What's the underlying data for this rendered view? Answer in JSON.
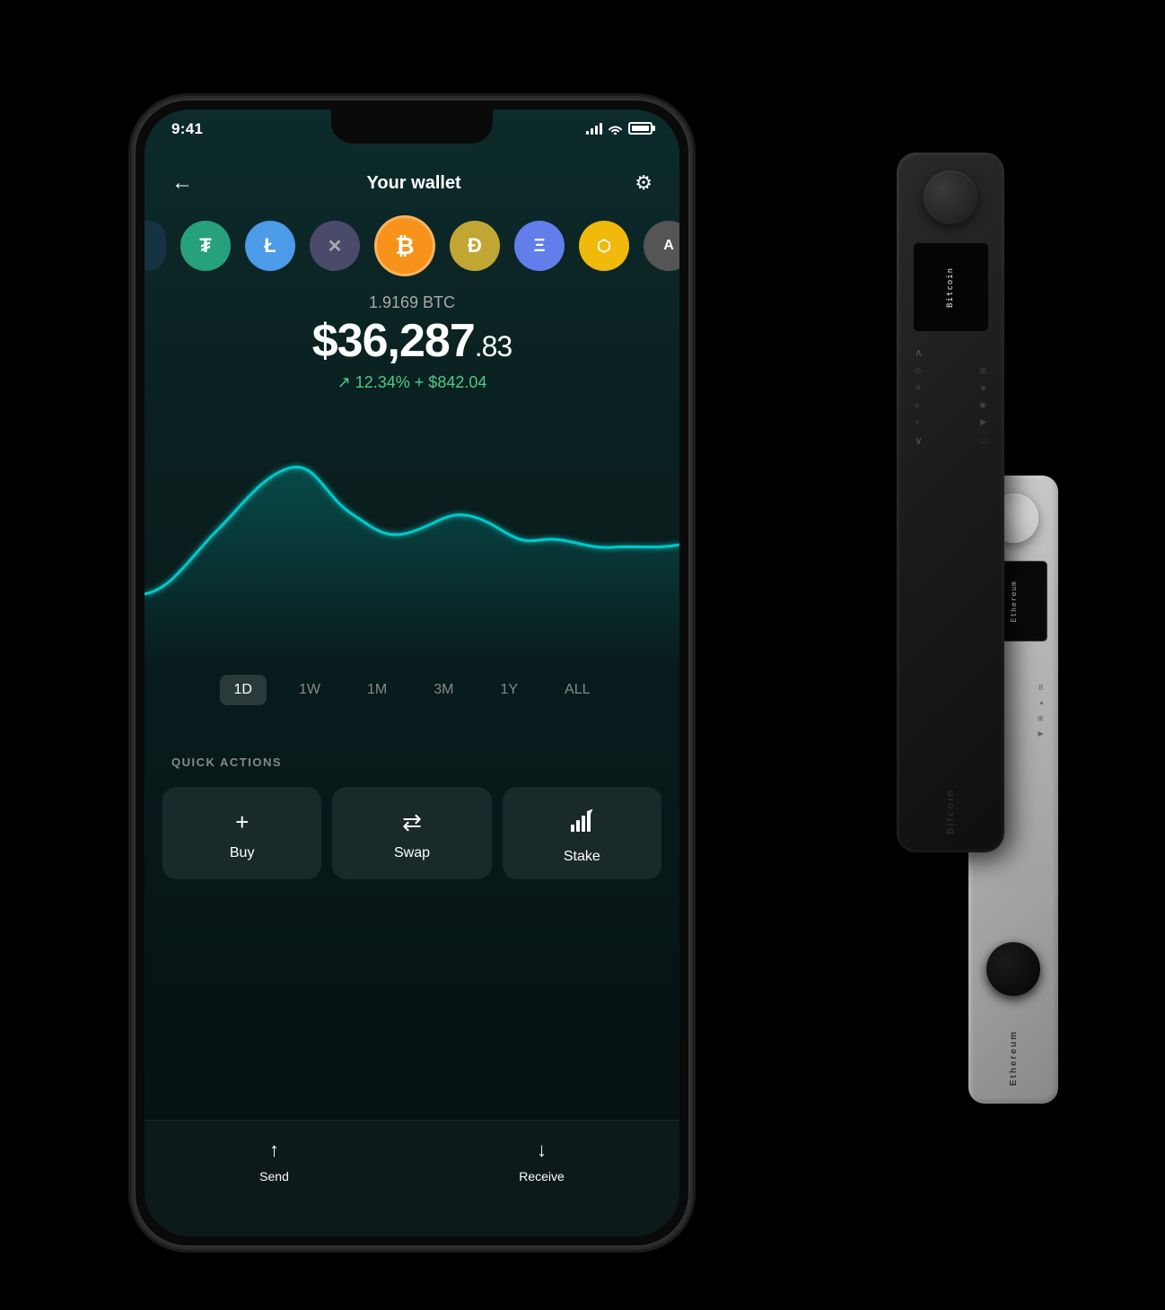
{
  "statusBar": {
    "time": "9:41",
    "signalBars": [
      4,
      7,
      10,
      13
    ],
    "wifi": true,
    "batteryFull": true
  },
  "header": {
    "back_label": "←",
    "title": "Your wallet",
    "settings_label": "⚙"
  },
  "coins": [
    {
      "id": "partial",
      "symbol": "",
      "color": "#1e3a5f"
    },
    {
      "id": "tether",
      "symbol": "₮",
      "color": "#26a17b"
    },
    {
      "id": "litecoin",
      "symbol": "Ł",
      "color": "#4c9be8"
    },
    {
      "id": "xrp",
      "symbol": "✕",
      "color": "#4a4a6a"
    },
    {
      "id": "bitcoin",
      "symbol": "₿",
      "color": "#f7931a",
      "active": true
    },
    {
      "id": "dogecoin",
      "symbol": "Ð",
      "color": "#c2a633"
    },
    {
      "id": "ethereum",
      "symbol": "Ξ",
      "color": "#627eea"
    },
    {
      "id": "bnb",
      "symbol": "⬡",
      "color": "#f0b90b"
    },
    {
      "id": "algo",
      "symbol": "A",
      "color": "#555"
    }
  ],
  "balance": {
    "crypto_amount": "1.9169 BTC",
    "fiat_whole": "$36,287",
    "fiat_cents": ".83",
    "change_percent": "12.34%",
    "change_amount": "+ $842.04",
    "change_arrow": "↗"
  },
  "chart": {
    "color": "#00c9c9",
    "glow_color": "rgba(0,201,201,0.3)"
  },
  "timeFilters": [
    {
      "label": "1D",
      "active": true
    },
    {
      "label": "1W",
      "active": false
    },
    {
      "label": "1M",
      "active": false
    },
    {
      "label": "3M",
      "active": false
    },
    {
      "label": "1Y",
      "active": false
    },
    {
      "label": "ALL",
      "active": false
    }
  ],
  "quickActions": {
    "label": "QUICK ACTIONS",
    "actions": [
      {
        "id": "buy",
        "icon": "+",
        "label": "Buy"
      },
      {
        "id": "swap",
        "icon": "⇄",
        "label": "Swap"
      },
      {
        "id": "stake",
        "icon": "📊",
        "label": "Stake"
      }
    ]
  },
  "bottomNav": [
    {
      "id": "send",
      "icon": "↑",
      "label": "Send"
    },
    {
      "id": "receive",
      "icon": "↓",
      "label": "Receive"
    }
  ],
  "ledgerX": {
    "display_text": "Bitcoin",
    "label": "Bitcoin"
  },
  "ledgerS": {
    "display_text": "Ethereum",
    "label": "Ethereum"
  }
}
